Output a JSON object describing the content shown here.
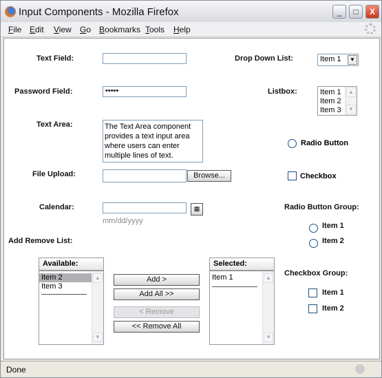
{
  "window": {
    "title": "Input Components - Mozilla Firefox",
    "min": "_",
    "max": "□",
    "close": "X"
  },
  "menu": [
    "File",
    "Edit",
    "View",
    "Go",
    "Bookmarks",
    "Tools",
    "Help"
  ],
  "form": {
    "text_field_label": "Text Field:",
    "text_field_value": "",
    "password_label": "Password Field:",
    "password_value": "•••••",
    "textarea_label": "Text Area:",
    "textarea_value": "The Text Area component provides a text input area where users can enter multiple lines of text.",
    "file_label": "File Upload:",
    "browse": "Browse...",
    "calendar_label": "Calendar:",
    "calendar_hint": "mm/dd/yyyy",
    "dropdown_label": "Drop Down List:",
    "dropdown_value": "Item 1",
    "listbox_label": "Listbox:",
    "listbox_items": [
      "Item 1",
      "Item 2",
      "Item 3"
    ],
    "radio_label": "Radio Button",
    "checkbox_label": "Checkbox",
    "radio_group_label": "Radio Button Group:",
    "radio_group": [
      "Item 1",
      "Item 2"
    ],
    "checkbox_group_label": "Checkbox Group:",
    "checkbox_group": [
      "Item 1",
      "Item 2"
    ]
  },
  "add_remove": {
    "label": "Add Remove List:",
    "available_header": "Available:",
    "available": [
      "Item 2",
      "Item 3"
    ],
    "selected_header": "Selected:",
    "selected": [
      "Item 1"
    ],
    "add": "Add >",
    "add_all": "Add All >>",
    "remove": "< Remove",
    "remove_all": "<< Remove All"
  },
  "status": {
    "text": "Done"
  }
}
